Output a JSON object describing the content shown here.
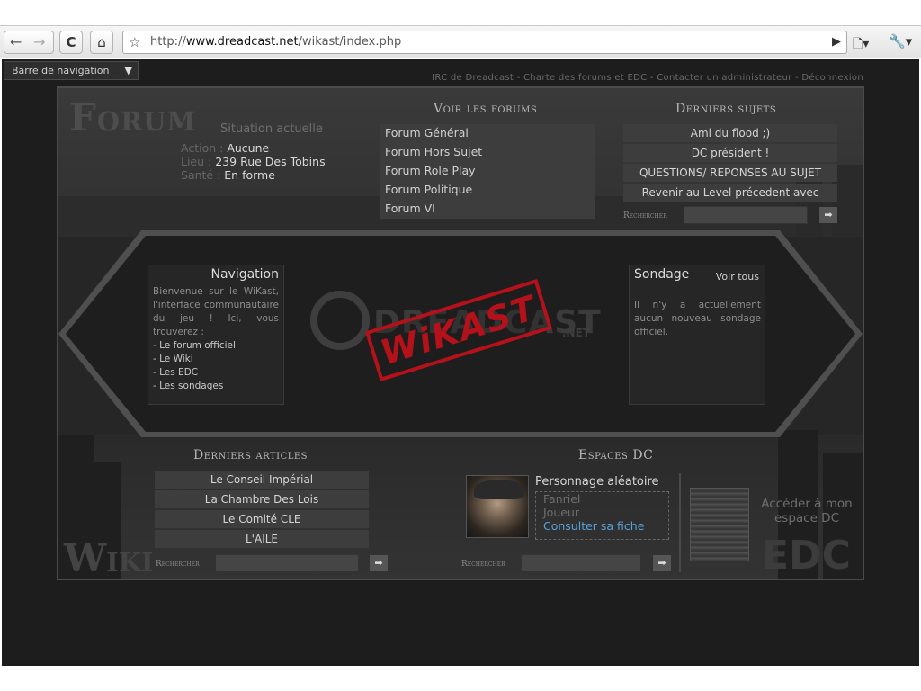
{
  "browser": {
    "url_prefix": "http://",
    "url_domain": "www.dreadcast.net",
    "url_path": "/wikast/index.php",
    "back": "←",
    "forward": "→",
    "reload": "C",
    "home": "⌂",
    "star": "☆",
    "go": "▶",
    "page_menu": "🗋▾",
    "wrench_menu": "🔧▾"
  },
  "navbar": {
    "label": "Barre de navigation",
    "caret": "▼"
  },
  "top_links": "IRC de Dreadcast - Charte des forums et EDC - Contacter un administrateur - Déconnexion",
  "forum": {
    "big_title": "Forum",
    "situation_title": "Situation actuelle",
    "action_label": "Action :",
    "action_value": "Aucune",
    "lieu_label": "Lieu :",
    "lieu_value": "239 Rue Des Tobins",
    "sante_label": "Santé :",
    "sante_value": "En forme"
  },
  "voir_forums": {
    "title": "Voir les forums",
    "items": [
      "Forum Général",
      "Forum Hors Sujet",
      "Forum Role Play",
      "Forum Politique",
      "Forum VI"
    ]
  },
  "derniers_sujets": {
    "title": "Derniers sujets",
    "items": [
      "Ami du flood ;)",
      "DC président !",
      "QUESTIONS/ REPONSES AU SUJET",
      "Revenir au Level précedent avec"
    ],
    "search_label": "Rechercher",
    "go": "➡"
  },
  "navigation": {
    "title": "Navigation",
    "text": "Bienvenue sur le WiKast, l'interface communautaire du jeu ! Ici, vous trouverez :",
    "links": [
      "- Le forum officiel",
      "- Le Wiki",
      "- Les EDC",
      "- Les sondages"
    ]
  },
  "sondage": {
    "title": "Sondage",
    "all": "Voir tous",
    "text": "Il n'y a actuellement aucun nouveau sondage officiel."
  },
  "logo": {
    "dc_text": "DREADCAST",
    "net": ".NET",
    "stamp": "WiKAST"
  },
  "articles": {
    "title": "Derniers articles",
    "items": [
      "Le Conseil Impérial",
      "La Chambre Des Lois",
      "Le Comité CLE",
      "L'AILE"
    ],
    "search_label": "Rechercher",
    "go": "➡",
    "wiki_big": "Wiki"
  },
  "espaces": {
    "title": "Espaces DC",
    "perso_title": "Personnage aléatoire",
    "perso_name": "Fanriel",
    "perso_role": "Joueur",
    "perso_link": "Consulter sa fiche",
    "search_label": "Rechercher",
    "go": "➡",
    "access": "Accéder à mon espace DC",
    "edc_big": "EDC"
  }
}
